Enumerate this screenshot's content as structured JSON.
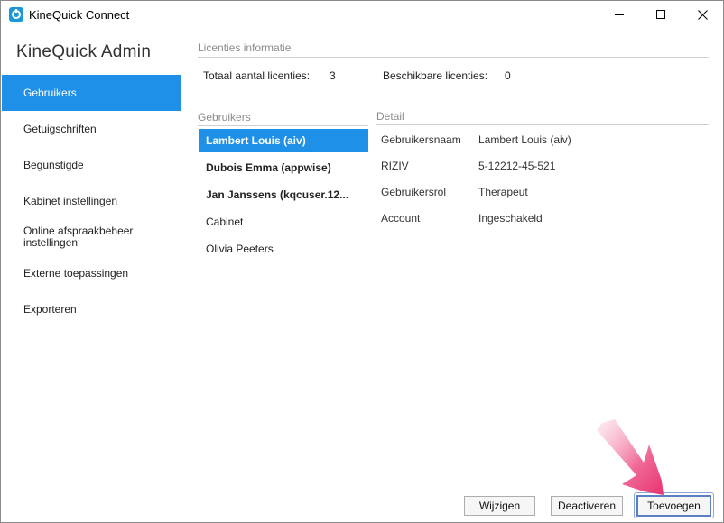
{
  "window": {
    "title": "KineQuick Connect"
  },
  "sidebar": {
    "title": "KineQuick Admin",
    "items": [
      {
        "label": "Gebruikers",
        "active": true
      },
      {
        "label": "Getuigschriften"
      },
      {
        "label": "Begunstigde"
      },
      {
        "label": "Kabinet instellingen"
      },
      {
        "label": "Online afspraakbeheer instellingen"
      },
      {
        "label": "Externe toepassingen"
      },
      {
        "label": "Exporteren"
      }
    ]
  },
  "licenses": {
    "header": "Licenties informatie",
    "total_label": "Totaal aantal licenties:",
    "total_value": "3",
    "available_label": "Beschikbare licenties:",
    "available_value": "0"
  },
  "users": {
    "header": "Gebruikers",
    "list": [
      {
        "name": "Lambert Louis (aiv)",
        "bold": true,
        "selected": true
      },
      {
        "name": "Dubois Emma (appwise)",
        "bold": true
      },
      {
        "name": "Jan Janssens (kqcuser.12...",
        "bold": true
      },
      {
        "name": "Cabinet"
      },
      {
        "name": "Olivia Peeters"
      }
    ]
  },
  "detail": {
    "header": "Detail",
    "rows": [
      {
        "label": "Gebruikersnaam",
        "value": "Lambert Louis (aiv)"
      },
      {
        "label": "RIZIV",
        "value": "5-12212-45-521"
      },
      {
        "label": "Gebruikersrol",
        "value": "Therapeut"
      },
      {
        "label": "Account",
        "value": "Ingeschakeld"
      }
    ]
  },
  "buttons": {
    "edit": "Wijzigen",
    "deactivate": "Deactiveren",
    "add": "Toevoegen"
  },
  "colors": {
    "accent": "#1e90e8",
    "app_icon": "#1c97d8",
    "annotation_arrow": "#f0457f"
  },
  "icons": {
    "app": "kinequick-logo-icon",
    "minimize": "minimize-icon",
    "maximize": "maximize-icon",
    "close": "close-icon",
    "annotation": "pointer-arrow-icon"
  }
}
